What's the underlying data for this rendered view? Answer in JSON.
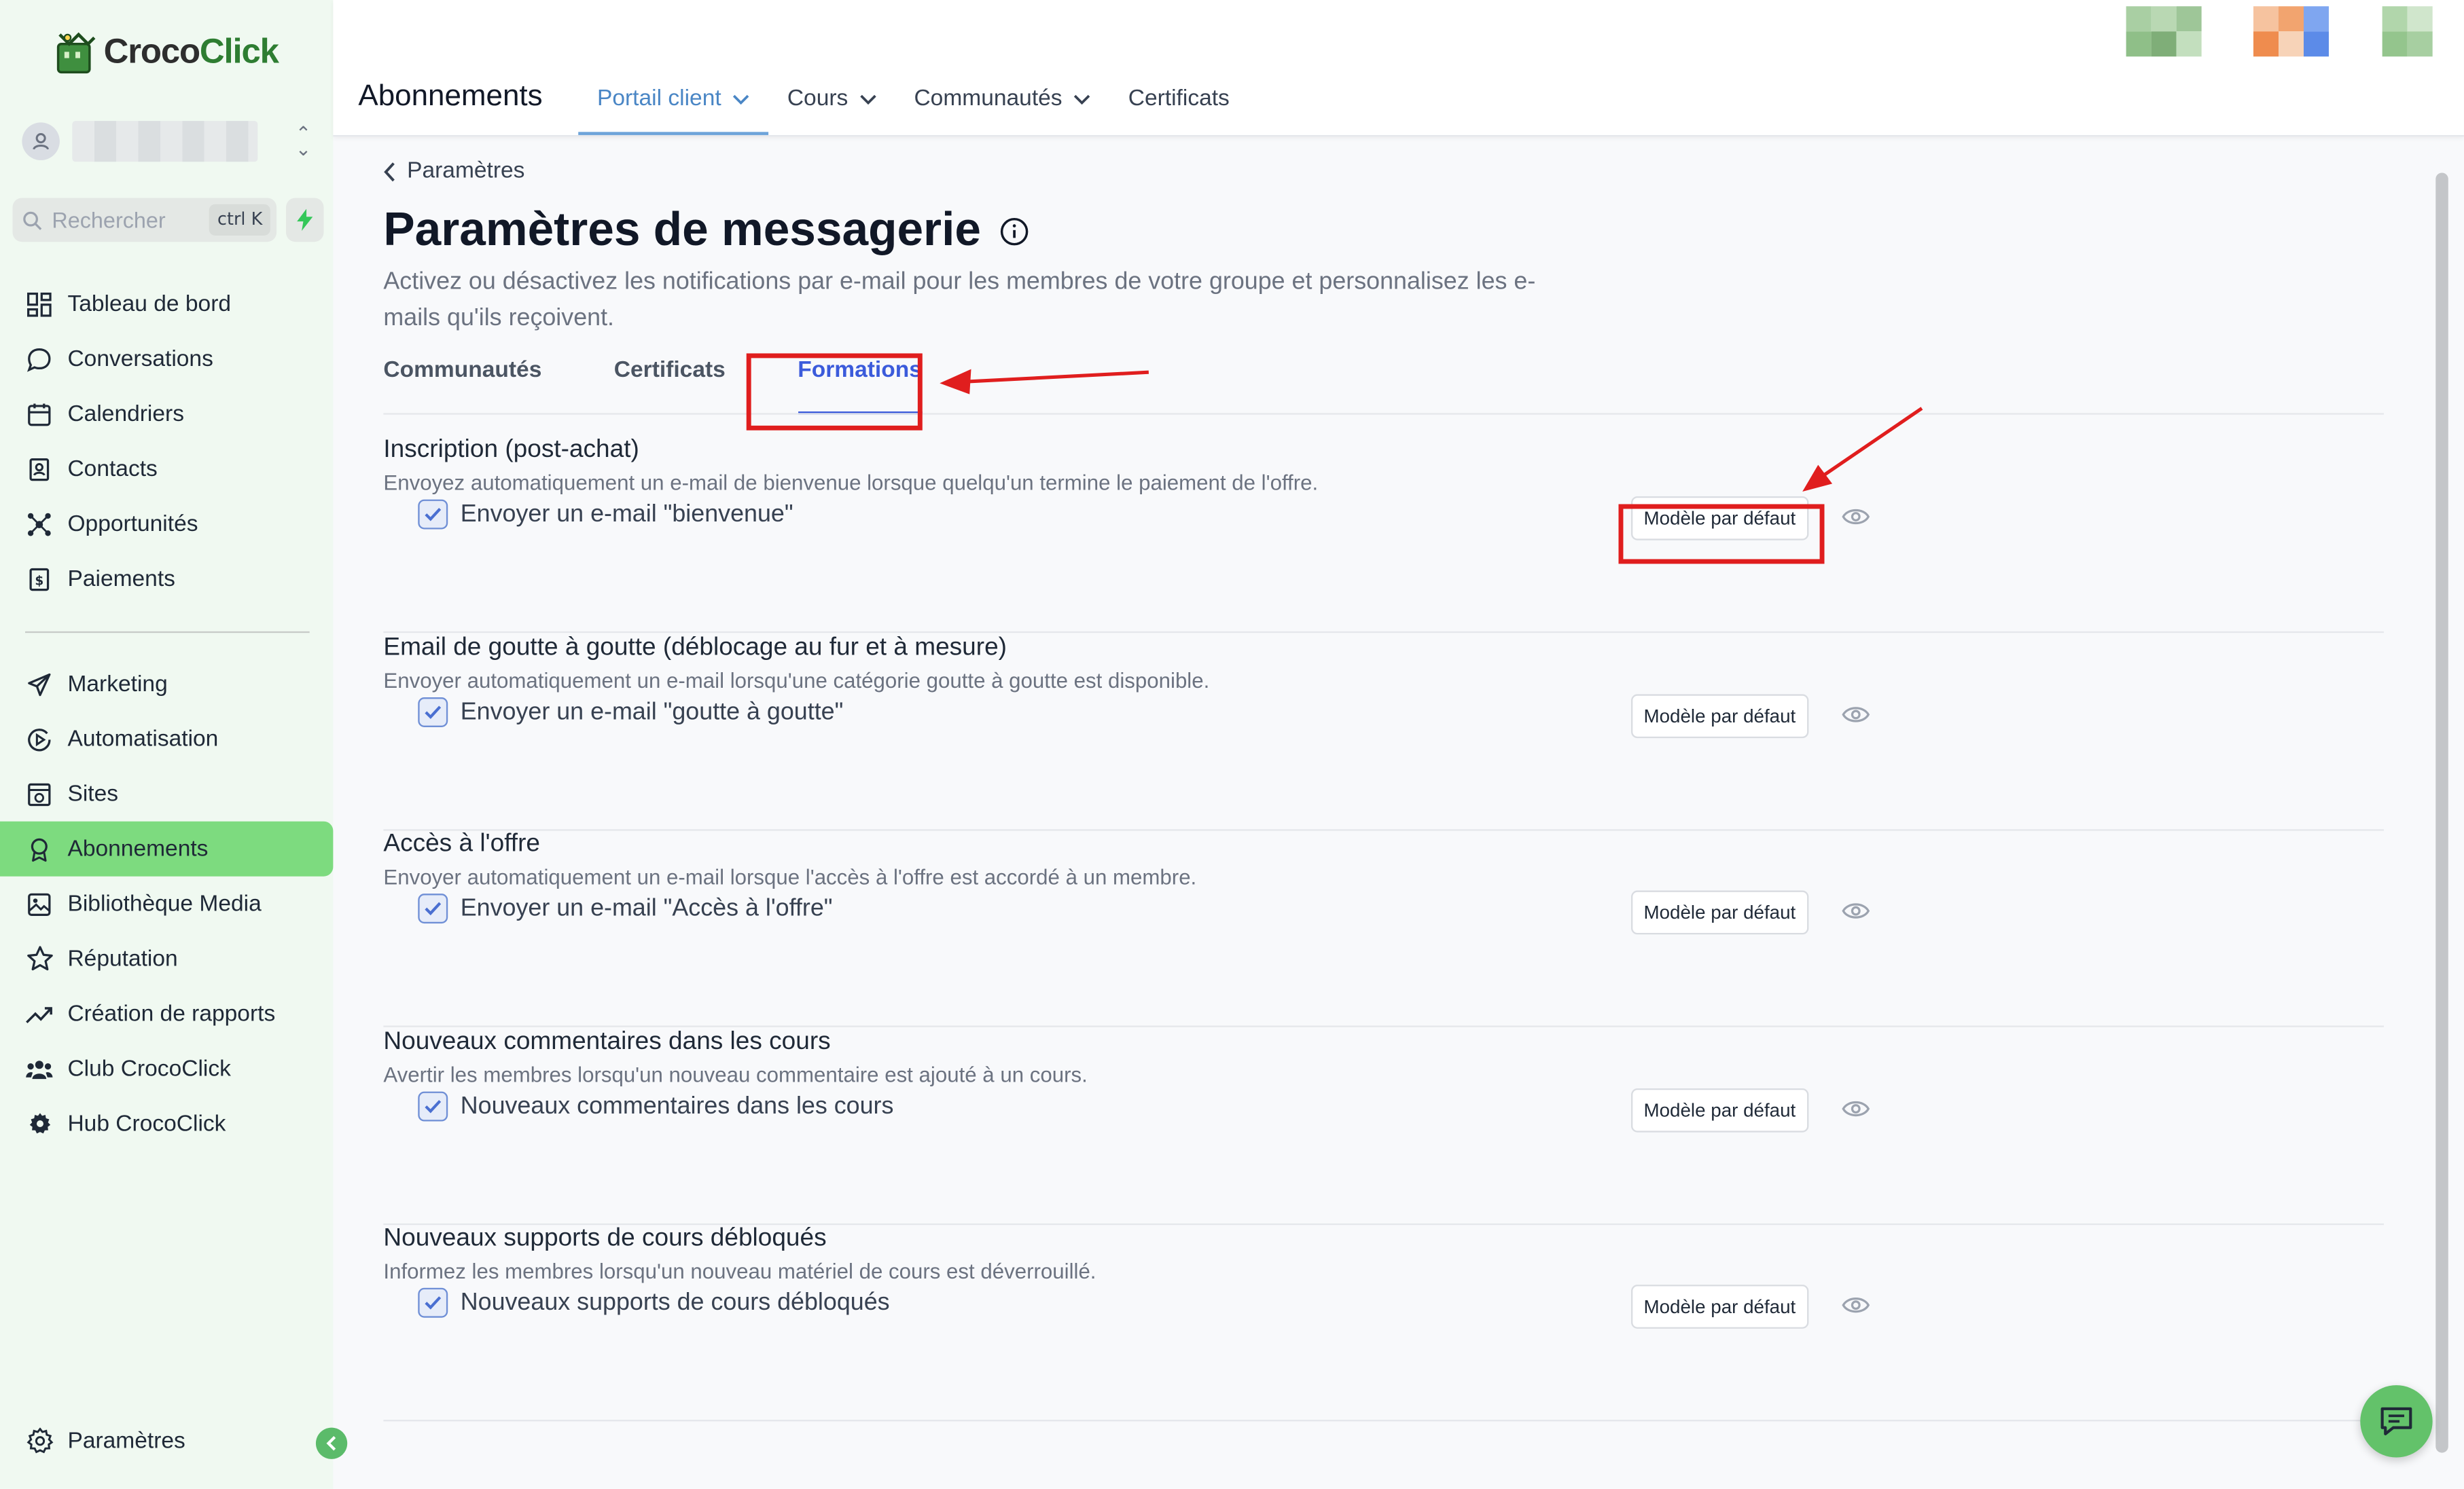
{
  "brand": {
    "name_part1": "Croco",
    "name_part2": "Click",
    "logo_icon": "crocodile-logo-icon"
  },
  "sidebar": {
    "search_placeholder": "Rechercher",
    "search_shortcut": "ctrl K",
    "items": [
      {
        "label": "Tableau de bord",
        "icon": "dashboard-icon"
      },
      {
        "label": "Conversations",
        "icon": "chat-bubble-icon"
      },
      {
        "label": "Calendriers",
        "icon": "calendar-icon"
      },
      {
        "label": "Contacts",
        "icon": "contacts-icon"
      },
      {
        "label": "Opportunités",
        "icon": "opportunities-icon"
      },
      {
        "label": "Paiements",
        "icon": "payments-icon"
      }
    ],
    "items2": [
      {
        "label": "Marketing",
        "icon": "send-icon"
      },
      {
        "label": "Automatisation",
        "icon": "automation-icon"
      },
      {
        "label": "Sites",
        "icon": "sites-icon"
      },
      {
        "label": "Abonnements",
        "icon": "badge-icon",
        "active": true
      },
      {
        "label": "Bibliothèque Media",
        "icon": "image-icon"
      },
      {
        "label": "Réputation",
        "icon": "star-icon"
      },
      {
        "label": "Création de rapports",
        "icon": "trend-icon"
      },
      {
        "label": "Club CrocoClick",
        "icon": "group-icon"
      },
      {
        "label": "Hub CrocoClick",
        "icon": "gear-icon"
      }
    ],
    "settings_label": "Paramètres"
  },
  "topbar": {
    "title": "Abonnements",
    "nav": [
      {
        "label": "Portail client",
        "dropdown": true,
        "active": true
      },
      {
        "label": "Cours",
        "dropdown": true
      },
      {
        "label": "Communautés",
        "dropdown": true
      },
      {
        "label": "Certificats",
        "dropdown": false
      }
    ]
  },
  "page": {
    "back_label": "Paramètres",
    "title": "Paramètres de messagerie",
    "description": "Activez ou désactivez les notifications par e-mail pour les membres de votre groupe et personnalisez les e-mails qu'ils reçoivent.",
    "tabs": [
      "Communautés",
      "Certificats",
      "Formations"
    ],
    "active_tab": "Formations",
    "template_button_label": "Modèle par défaut",
    "sections": [
      {
        "title": "Inscription (post-achat)",
        "description": "Envoyez automatiquement un e-mail de bienvenue lorsque quelqu'un termine le paiement de l'offre.",
        "checkbox_label": "Envoyer un e-mail \"bienvenue\"",
        "checked": true
      },
      {
        "title": "Email de goutte à goutte (déblocage au fur et à mesure)",
        "description": "Envoyer automatiquement un e-mail lorsqu'une catégorie goutte à goutte est disponible.",
        "checkbox_label": "Envoyer un e-mail \"goutte à goutte\"",
        "checked": true
      },
      {
        "title": "Accès à l'offre",
        "description": "Envoyer automatiquement un e-mail lorsque l'accès à l'offre est accordé à un membre.",
        "checkbox_label": "Envoyer un e-mail \"Accès à l'offre\"",
        "checked": true
      },
      {
        "title": "Nouveaux commentaires dans les cours",
        "description": "Avertir les membres lorsqu'un nouveau commentaire est ajouté à un cours.",
        "checkbox_label": "Nouveaux commentaires dans les cours",
        "checked": true
      },
      {
        "title": "Nouveaux supports de cours débloqués",
        "description": "Informez les membres lorsqu'un nouveau matériel de cours est déverrouillé.",
        "checkbox_label": "Nouveaux supports de cours débloqués",
        "checked": true
      }
    ]
  },
  "colors": {
    "accent_green": "#7ddb7f",
    "tab_active": "#3b5bdb",
    "annotation_red": "#e01e1e"
  }
}
